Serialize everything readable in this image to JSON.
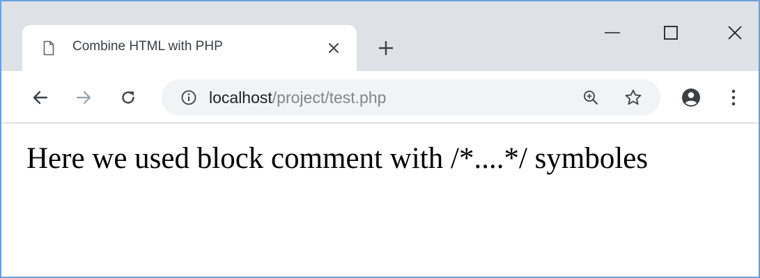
{
  "tab": {
    "title": "Combine HTML with PHP",
    "favicon": "page-icon"
  },
  "toolbar": {
    "icons": [
      "back-arrow-icon",
      "forward-arrow-icon",
      "reload-icon"
    ]
  },
  "omnibox": {
    "host": "localhost",
    "path": "/project/test.php",
    "left_icon": "info-icon",
    "right_icons": [
      "zoom-icon",
      "star-icon"
    ]
  },
  "page": {
    "text": "Here we used block comment with /*....*/ symboles"
  },
  "colors": {
    "frame": "#6d9fd9",
    "tabstrip": "#dee1e6",
    "omnibox": "#f1f3f4",
    "url_path": "#80868b"
  }
}
